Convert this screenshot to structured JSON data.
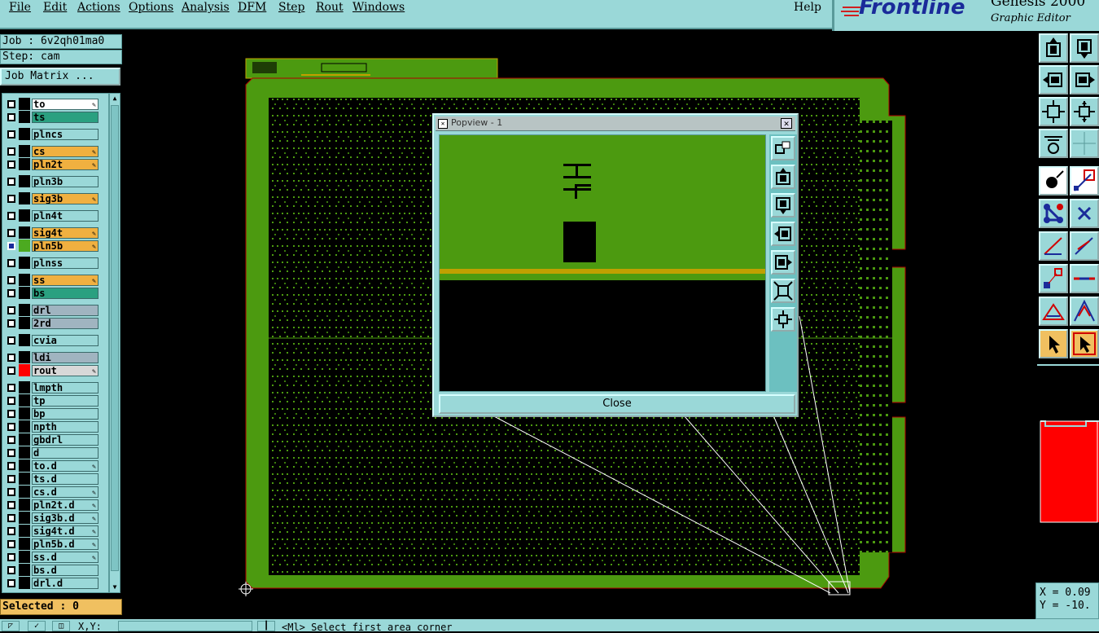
{
  "menu": {
    "items": [
      "File",
      "Edit",
      "Actions",
      "Options",
      "Analysis",
      "DFM",
      "Step",
      "Rout",
      "Windows"
    ],
    "help": "Help"
  },
  "brand": {
    "name": "Frontline",
    "product": "Genesis 2000",
    "subtitle": "Graphic Editor"
  },
  "job": {
    "job_line": "Job : 6v2qh01ma0",
    "step_line": "Step: cam",
    "matrix_button": "Job Matrix ..."
  },
  "layers": [
    {
      "name": "to",
      "color": "#ffffff",
      "swatch": "#000000",
      "edit": true
    },
    {
      "name": "ts",
      "color": "#2aa080",
      "swatch": "#000000",
      "edit": false
    },
    {
      "name": "plncs",
      "color": "#9ad8d8",
      "swatch": "#000000",
      "edit": false
    },
    {
      "name": "cs",
      "color": "#f0b040",
      "swatch": "#000000",
      "edit": true
    },
    {
      "name": "pln2t",
      "color": "#f0b040",
      "swatch": "#000000",
      "edit": true
    },
    {
      "name": "pln3b",
      "color": "#9ad8d8",
      "swatch": "#000000",
      "edit": false
    },
    {
      "name": "sig3b",
      "color": "#f0b040",
      "swatch": "#000000",
      "edit": true
    },
    {
      "name": "pln4t",
      "color": "#9ad8d8",
      "swatch": "#000000",
      "edit": false
    },
    {
      "name": "sig4t",
      "color": "#f0b040",
      "swatch": "#000000",
      "edit": true
    },
    {
      "name": "pln5b",
      "color": "#f0b040",
      "swatch": "#4caa20",
      "edit": true
    },
    {
      "name": "plnss",
      "color": "#9ad8d8",
      "swatch": "#000000",
      "edit": false
    },
    {
      "name": "ss",
      "color": "#f0b040",
      "swatch": "#000000",
      "edit": true
    },
    {
      "name": "bs",
      "color": "#2aa080",
      "swatch": "#000000",
      "edit": false
    },
    {
      "name": "drl",
      "color": "#a0b4c0",
      "swatch": "#000000",
      "edit": false
    },
    {
      "name": "2rd",
      "color": "#a0b4c0",
      "swatch": "#000000",
      "edit": false
    },
    {
      "name": "cvia",
      "color": "#9ad8d8",
      "swatch": "#000000",
      "edit": false
    },
    {
      "name": "ldi",
      "color": "#a0b4c0",
      "swatch": "#000000",
      "edit": false
    },
    {
      "name": "rout",
      "color": "#d8d8d8",
      "swatch": "#ff0000",
      "edit": true
    },
    {
      "name": "lmpth",
      "color": "#9ad8d8",
      "swatch": "#000000",
      "edit": false
    },
    {
      "name": "tp",
      "color": "#9ad8d8",
      "swatch": "#000000",
      "edit": false
    },
    {
      "name": "bp",
      "color": "#9ad8d8",
      "swatch": "#000000",
      "edit": false
    },
    {
      "name": "npth",
      "color": "#9ad8d8",
      "swatch": "#000000",
      "edit": false
    },
    {
      "name": "gbdrl",
      "color": "#9ad8d8",
      "swatch": "#000000",
      "edit": false
    },
    {
      "name": "d",
      "color": "#9ad8d8",
      "swatch": "#000000",
      "edit": false
    },
    {
      "name": "to.d",
      "color": "#9ad8d8",
      "swatch": "#000000",
      "edit": true
    },
    {
      "name": "ts.d",
      "color": "#9ad8d8",
      "swatch": "#000000",
      "edit": false
    },
    {
      "name": "cs.d",
      "color": "#9ad8d8",
      "swatch": "#000000",
      "edit": true
    },
    {
      "name": "pln2t.d",
      "color": "#9ad8d8",
      "swatch": "#000000",
      "edit": true
    },
    {
      "name": "sig3b.d",
      "color": "#9ad8d8",
      "swatch": "#000000",
      "edit": true
    },
    {
      "name": "sig4t.d",
      "color": "#9ad8d8",
      "swatch": "#000000",
      "edit": true
    },
    {
      "name": "pln5b.d",
      "color": "#9ad8d8",
      "swatch": "#000000",
      "edit": true
    },
    {
      "name": "ss.d",
      "color": "#9ad8d8",
      "swatch": "#000000",
      "edit": true
    },
    {
      "name": "bs.d",
      "color": "#9ad8d8",
      "swatch": "#000000",
      "edit": false
    },
    {
      "name": "drl.d",
      "color": "#9ad8d8",
      "swatch": "#000000",
      "edit": false
    }
  ],
  "status": {
    "selected": "Selected : 0"
  },
  "popview": {
    "title": "Popview - 1",
    "close_label": "Close"
  },
  "bottom": {
    "xy_label": "X,Y:",
    "xy_value": "",
    "prompt": "<Ml>  Select first area corner"
  },
  "coords": {
    "x": "X = 0.09",
    "y": "Y = -10."
  },
  "colors": {
    "panel": "#9ad8d8",
    "board": "#4c9a10",
    "highlight": "#f0b040",
    "selection": "#ff0000"
  }
}
